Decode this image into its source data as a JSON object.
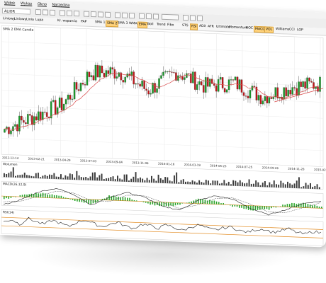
{
  "menu": {
    "items": [
      "Widok",
      "Wykaz",
      "Okno",
      "Narzędzia"
    ]
  },
  "toolbar": {
    "symbol": "ALIOR"
  },
  "indicator_bar": {
    "items": [
      {
        "label": "Liniowy",
        "active": false
      },
      {
        "label": "Liniowy",
        "active": false
      },
      {
        "label": "Linia",
        "active": false
      },
      {
        "label": "Lupa",
        "active": false
      },
      {
        "label": "Kr. wsparcia",
        "active": false
      },
      {
        "label": "PAP",
        "active": false
      },
      {
        "label": "SMA 1",
        "active": false
      },
      {
        "label": "SMA 2",
        "active": true
      },
      {
        "label": "SMA 3",
        "active": false
      },
      {
        "label": "WMA",
        "active": false
      },
      {
        "label": "EMA",
        "active": true
      },
      {
        "label": "Boll",
        "active": false
      },
      {
        "label": "Trend",
        "active": false
      },
      {
        "label": "Fibo",
        "active": false
      },
      {
        "label": "STS",
        "active": false
      },
      {
        "label": "RSI",
        "active": true
      },
      {
        "label": "ADX",
        "active": false
      },
      {
        "label": "ATR",
        "active": false
      },
      {
        "label": "Ultimate",
        "active": false
      },
      {
        "label": "Momentum",
        "active": false
      },
      {
        "label": "ROC",
        "active": false
      },
      {
        "label": "MACD",
        "active": true
      },
      {
        "label": "VOL",
        "active": true
      },
      {
        "label": "Williams",
        "active": false
      },
      {
        "label": "CCI",
        "active": false
      },
      {
        "label": "LOP",
        "active": false
      }
    ]
  },
  "chart_data": [
    {
      "type": "candlestick",
      "title": "SMA 2  EMA  Candle",
      "dates": [
        "2012-12-14",
        "2013-02-21",
        "2013-04-29",
        "2013-07-03",
        "2013-09-04",
        "2013-11-06",
        "2014-01-16",
        "2014-03-19",
        "2014-05-23",
        "2014-07-25",
        "2014-09-26",
        "2014-11-28",
        "2015-02"
      ],
      "close": [
        28,
        40,
        52,
        82,
        84,
        68,
        86,
        74,
        78,
        66,
        76,
        80
      ],
      "high": [
        34,
        56,
        92,
        104,
        112,
        84,
        108,
        100,
        92,
        92,
        96,
        98
      ],
      "low": [
        24,
        38,
        48,
        72,
        74,
        56,
        80,
        68,
        70,
        58,
        60,
        68
      ],
      "colors": {
        "up": "#1a9a2b",
        "down": "#c0161a",
        "sma": "#d94c4c",
        "ema": "#e08a8a"
      }
    },
    {
      "type": "bar",
      "title": "Wolumen",
      "values": [
        4,
        2,
        3,
        5,
        6,
        2,
        3,
        4,
        2,
        3,
        2,
        4,
        3,
        2,
        5,
        3,
        2,
        4
      ]
    },
    {
      "type": "line",
      "title": "MACD(26,12,9)",
      "series": [
        {
          "name": "MACD",
          "values": [
            -6,
            -2,
            4,
            7,
            3,
            -4,
            2,
            6,
            3,
            -3,
            -5,
            2,
            6,
            4,
            -2,
            -6,
            -2,
            3,
            5
          ]
        },
        {
          "name": "Signal",
          "values": [
            -4,
            -3,
            1,
            5,
            4,
            -1,
            -1,
            4,
            4,
            0,
            -4,
            -1,
            4,
            5,
            1,
            -4,
            -4,
            0,
            4
          ]
        }
      ],
      "colors": {
        "macd": "#222222",
        "signal": "#444444",
        "hist": "#2aa52a",
        "zero": "#e28a1f"
      }
    },
    {
      "type": "line",
      "title": "RSI(14)",
      "values": [
        48,
        62,
        40,
        70,
        55,
        45,
        66,
        52,
        38,
        60,
        72,
        58,
        44,
        55,
        68,
        50,
        42,
        63,
        57,
        46,
        64,
        52,
        40,
        58,
        70,
        55,
        48,
        60,
        66,
        50,
        44,
        58,
        62,
        48,
        56,
        68,
        52,
        45,
        60,
        54
      ],
      "levels": [
        70,
        30
      ],
      "colors": {
        "line": "#222222",
        "level": "#e28a1f"
      }
    }
  ]
}
